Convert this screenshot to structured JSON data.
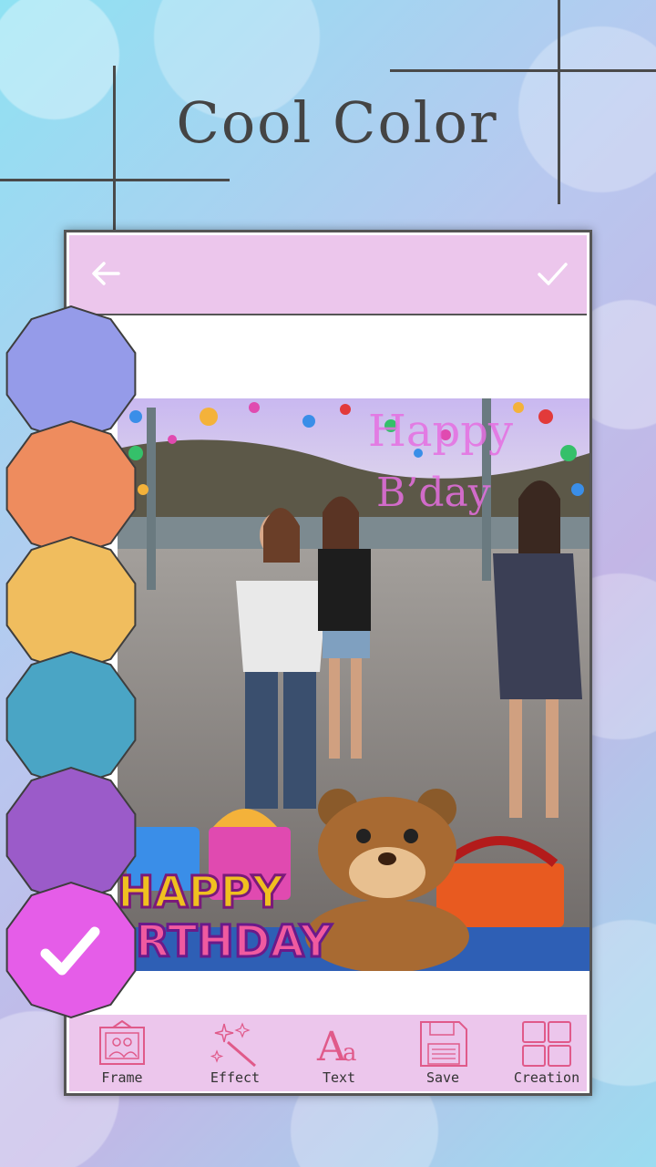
{
  "promo": {
    "title": "Cool Color"
  },
  "toolbar": {
    "back_icon": "arrow-left-icon",
    "confirm_icon": "check-icon"
  },
  "photo": {
    "greeting_line1": "Happy",
    "greeting_line2": "B’day",
    "banner_line1": "HAPPY",
    "banner_line2": "RTHDAY"
  },
  "bottom_tools": [
    {
      "label": "Frame",
      "icon": "frame-icon"
    },
    {
      "label": "Effect",
      "icon": "magic-wand-icon"
    },
    {
      "label": "Text",
      "icon": "text-icon"
    },
    {
      "label": "Save",
      "icon": "floppy-disk-icon"
    },
    {
      "label": "Creation",
      "icon": "grid-icon"
    }
  ],
  "color_palette": {
    "colors": [
      "#959be9",
      "#ee8c5e",
      "#f0bd5e",
      "#4aa5c5",
      "#9b5bc9",
      "#e55de8"
    ],
    "selected_index": 5,
    "selected_icon": "check-icon"
  },
  "theme": {
    "accent": "#ecc6ec",
    "icon_color": "#e05a8a"
  }
}
